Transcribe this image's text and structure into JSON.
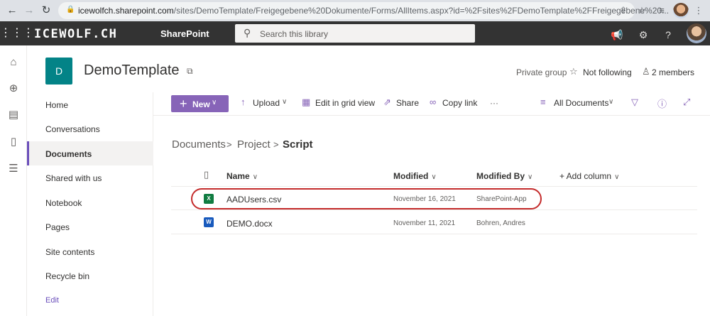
{
  "browser": {
    "url_host": "icewolfch.sharepoint.com",
    "url_path": "/sites/DemoTemplate/Freigegebene%20Dokumente/Forms/AllItems.aspx?id=%2Fsites%2FDemoTemplate%2FFreigegebene%20..."
  },
  "suite": {
    "brand": "ICEWOLF.CH",
    "app_name": "SharePoint",
    "search_placeholder": "Search this library",
    "help_label": "?"
  },
  "site": {
    "logo_letter": "D",
    "title": "DemoTemplate",
    "privacy": "Private group",
    "follow_label": "Not following",
    "members_label": "2 members"
  },
  "leftnav": {
    "items": [
      {
        "label": "Home"
      },
      {
        "label": "Conversations"
      },
      {
        "label": "Documents",
        "selected": true
      },
      {
        "label": "Shared with us"
      },
      {
        "label": "Notebook"
      },
      {
        "label": "Pages"
      },
      {
        "label": "Site contents"
      },
      {
        "label": "Recycle bin"
      },
      {
        "label": "Edit"
      }
    ]
  },
  "commandbar": {
    "new_label": "New",
    "upload_label": "Upload",
    "grid_label": "Edit in grid view",
    "share_label": "Share",
    "copylink_label": "Copy link",
    "more_label": "···",
    "view_label": "All Documents"
  },
  "breadcrumb": {
    "items": [
      "Documents",
      "Project",
      "Script"
    ],
    "separator": ">"
  },
  "list": {
    "columns": {
      "name": "Name",
      "modified": "Modified",
      "modified_by": "Modified By",
      "add_column": "+ Add column"
    },
    "rows": [
      {
        "name": "AADUsers.csv",
        "modified": "November 16, 2021",
        "modified_by": "SharePoint-App",
        "icon": "excel-file-icon",
        "highlighted": true
      },
      {
        "name": "DEMO.docx",
        "modified": "November 11, 2021",
        "modified_by": "Bohren, Andres",
        "icon": "word-file-icon",
        "highlighted": false
      }
    ]
  },
  "colors": {
    "accent": "#8764b8",
    "suite_bar": "#333333",
    "site_logo": "#038387",
    "highlight": "#c42b2b"
  }
}
